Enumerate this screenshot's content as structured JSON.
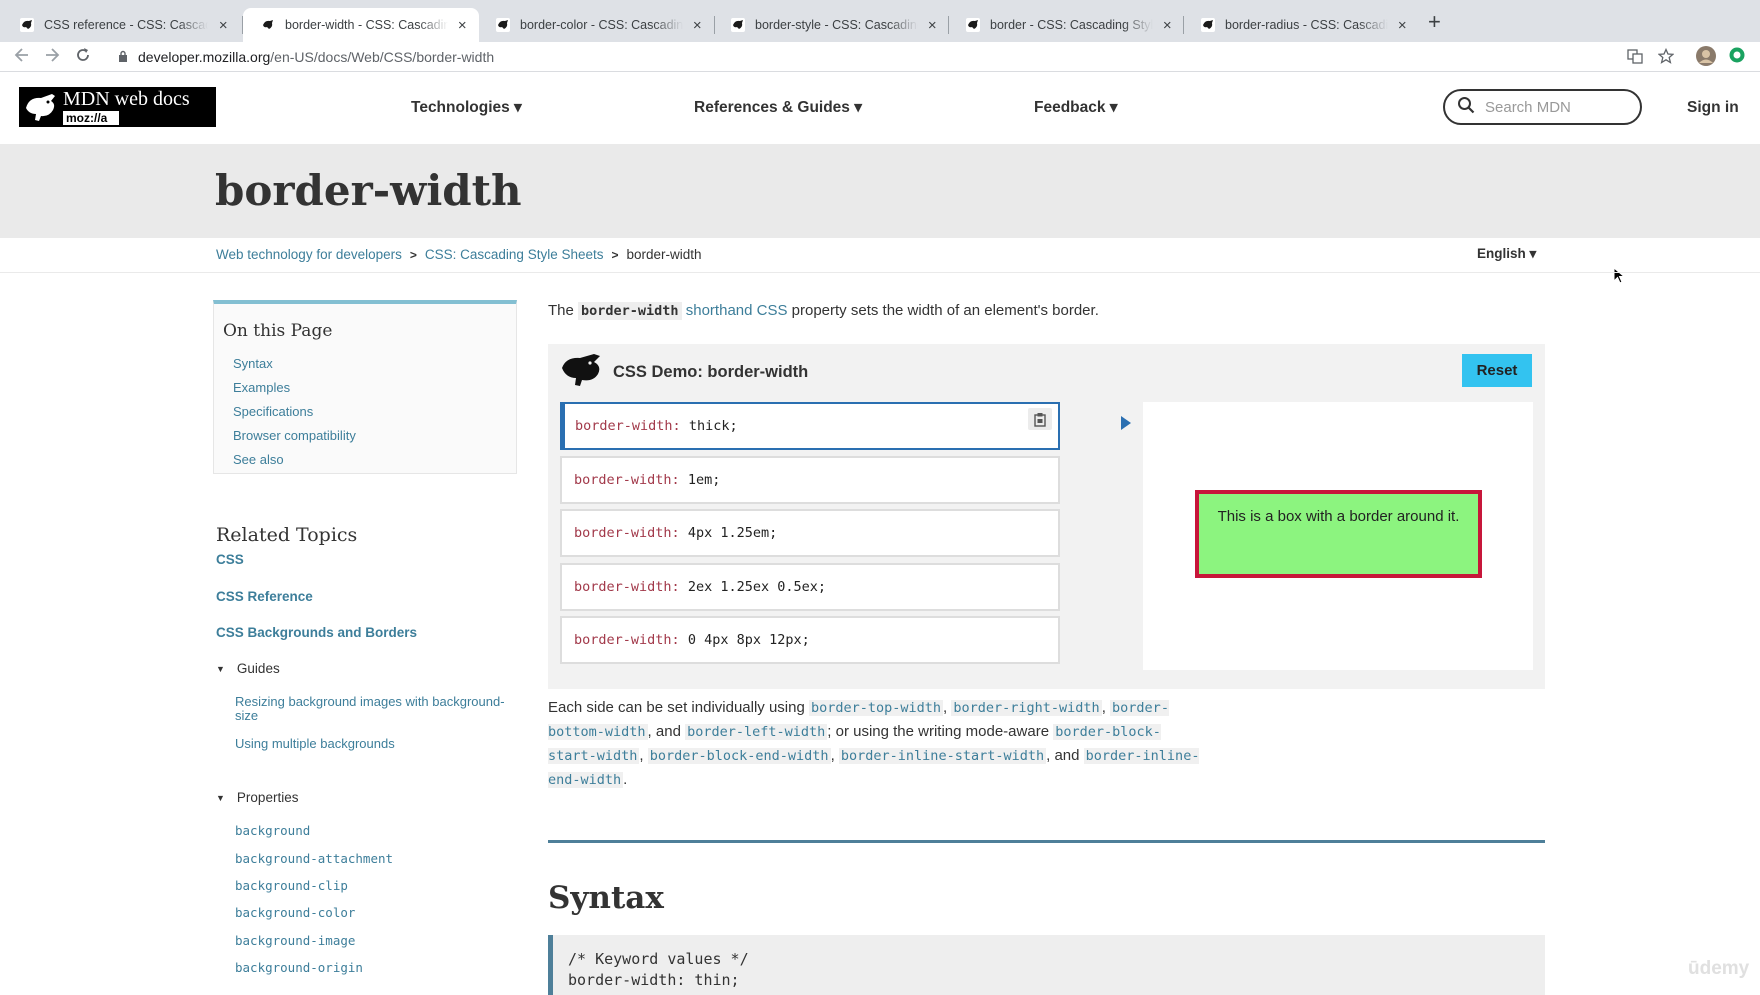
{
  "browser": {
    "tabs": [
      {
        "label": "CSS reference - CSS: Cascading Style Sheets",
        "active": false
      },
      {
        "label": "border-width - CSS: Cascading Style Sheets",
        "active": true
      },
      {
        "label": "border-color - CSS: Cascading Style Sheets",
        "active": false
      },
      {
        "label": "border-style - CSS: Cascading Style Sheets",
        "active": false
      },
      {
        "label": "border - CSS: Cascading Style Sheets",
        "active": false
      },
      {
        "label": "border-radius - CSS: Cascading Style Sheets",
        "active": false
      }
    ],
    "url_host": "developer.mozilla.org",
    "url_path": "/en-US/docs/Web/CSS/border-width",
    "close_glyph": "×",
    "new_tab_glyph": "+"
  },
  "header": {
    "logo_line1": "MDN web docs",
    "logo_line2": "moz://a",
    "nav": {
      "technologies": "Technologies ▾",
      "references": "References & Guides ▾",
      "feedback": "Feedback ▾"
    },
    "search_placeholder": "Search MDN",
    "sign_in": "Sign in"
  },
  "page": {
    "title": "border-width",
    "breadcrumb": [
      "Web technology for developers",
      "CSS: Cascading Style Sheets",
      "border-width"
    ],
    "language": "English ▾"
  },
  "toc": {
    "heading": "On this Page",
    "items": [
      "Syntax",
      "Examples",
      "Specifications",
      "Browser compatibility",
      "See also"
    ]
  },
  "related": {
    "heading": "Related Topics",
    "main_links": [
      "CSS",
      "CSS Reference",
      "CSS Backgrounds and Borders"
    ],
    "guides_label": "Guides",
    "guides": [
      "Resizing background images with background-size",
      "Using multiple backgrounds"
    ],
    "properties_label": "Properties",
    "properties": [
      "background",
      "background-attachment",
      "background-clip",
      "background-color",
      "background-image",
      "background-origin"
    ]
  },
  "intro": {
    "the": "The",
    "code": "border-width",
    "link": "shorthand CSS",
    "rest": "property sets the width of an element's border."
  },
  "demo": {
    "title": "CSS Demo: border-width",
    "reset": "Reset",
    "property": "border-width:",
    "choices": [
      "thick;",
      "1em;",
      "4px 1.25em;",
      "2ex 1.25ex 0.5ex;",
      "0 4px 8px 12px;"
    ],
    "selected_index": 0,
    "box_text": "This is a box with a border around it."
  },
  "para2": {
    "t1": "Each side can be set individually using",
    "c1": "border-top-width",
    "c2": "border-right-width",
    "c3": "border-bottom-width",
    "t2": ", and",
    "c4": "border-left-width",
    "t3": "; or using the writing mode-aware",
    "c5": "border-block-start-width",
    "c6": "border-block-end-width",
    "c7": "border-inline-start-width",
    "t4": ", and",
    "c8": "border-inline-end-width"
  },
  "syntax": {
    "heading": "Syntax",
    "code_line1": "/* Keyword values */",
    "code_line2": "border-width: thin;"
  },
  "watermark": "ūdemy",
  "colors": {
    "link": "#3d7e9a",
    "demo_box_bg": "#8cf47f",
    "demo_box_border": "#c7163a",
    "reset_bg": "#33c3f0",
    "selected_border": "#2a6fb1"
  }
}
